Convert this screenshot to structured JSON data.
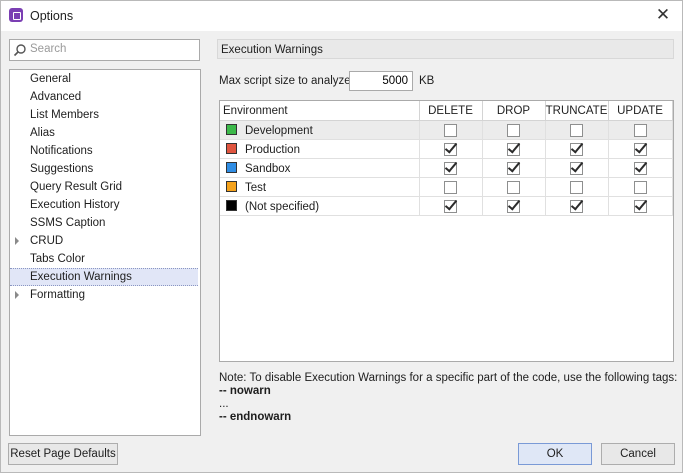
{
  "window": {
    "title": "Options",
    "close_glyph": "✕"
  },
  "search": {
    "placeholder": "Search",
    "value": ""
  },
  "tree": [
    {
      "label": "General",
      "expandable": false,
      "selected": false
    },
    {
      "label": "Advanced",
      "expandable": false,
      "selected": false
    },
    {
      "label": "List Members",
      "expandable": false,
      "selected": false
    },
    {
      "label": "Alias",
      "expandable": false,
      "selected": false
    },
    {
      "label": "Notifications",
      "expandable": false,
      "selected": false
    },
    {
      "label": "Suggestions",
      "expandable": false,
      "selected": false
    },
    {
      "label": "Query Result Grid",
      "expandable": false,
      "selected": false
    },
    {
      "label": "Execution History",
      "expandable": false,
      "selected": false
    },
    {
      "label": "SSMS Caption",
      "expandable": false,
      "selected": false
    },
    {
      "label": "CRUD",
      "expandable": true,
      "selected": false
    },
    {
      "label": "Tabs Color",
      "expandable": false,
      "selected": false
    },
    {
      "label": "Execution Warnings",
      "expandable": false,
      "selected": true
    },
    {
      "label": "Formatting",
      "expandable": true,
      "selected": false
    }
  ],
  "main": {
    "header": "Execution Warnings",
    "max_size_label": "Max script size to analyze:",
    "max_size_value": "5000",
    "max_size_unit": "KB",
    "columns": [
      "Environment",
      "DELETE",
      "DROP",
      "TRUNCATE",
      "UPDATE"
    ],
    "rows": [
      {
        "name": "Development",
        "color": "#3cb94a",
        "checks": [
          false,
          false,
          false,
          false
        ]
      },
      {
        "name": "Production",
        "color": "#e0553f",
        "checks": [
          true,
          true,
          true,
          true
        ]
      },
      {
        "name": "Sandbox",
        "color": "#2f8de4",
        "checks": [
          true,
          true,
          true,
          true
        ]
      },
      {
        "name": "Test",
        "color": "#f5a21b",
        "checks": [
          false,
          false,
          false,
          false
        ]
      },
      {
        "name": "(Not specified)",
        "color": "#000000",
        "checks": [
          true,
          true,
          true,
          true
        ]
      }
    ],
    "note_line1": "Note: To disable Execution Warnings for a specific part of the code, use the following tags:",
    "note_line2": "-- nowarn",
    "note_line3": "...",
    "note_line4": "-- endnowarn"
  },
  "buttons": {
    "reset": "Reset Page Defaults",
    "ok": "OK",
    "cancel": "Cancel"
  }
}
